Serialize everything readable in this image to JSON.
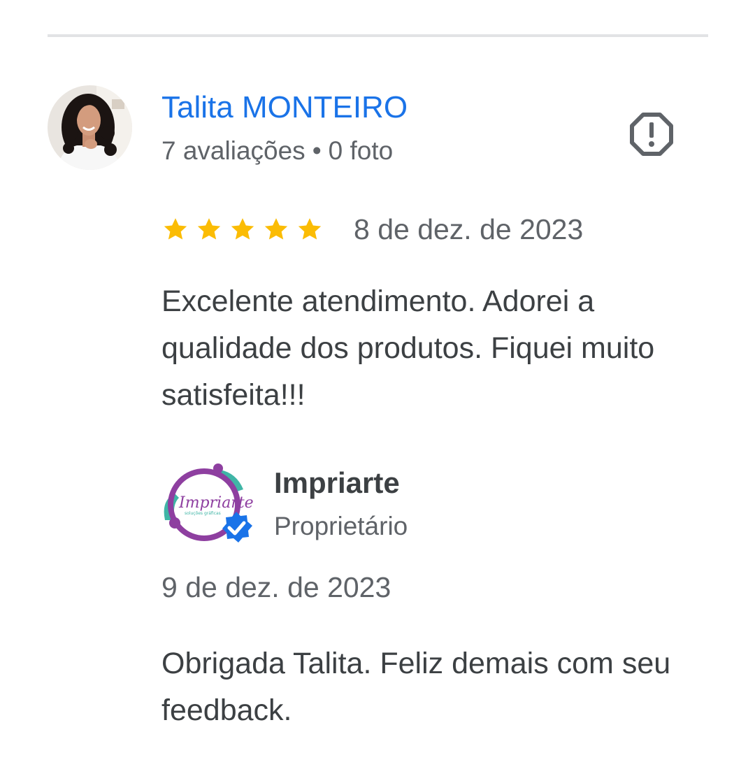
{
  "review": {
    "reviewer_name": "Talita MONTEIRO",
    "reviewer_reviews": "7 avaliações",
    "meta_separator": "•",
    "reviewer_photos": "0 foto",
    "rating": 5,
    "rating_max": 5,
    "date": "8 de dez. de 2023",
    "text": "Excelente atendimento. Adorei a qualidade dos produtos. Fiquei muito satisfeita!!!",
    "icons": {
      "report": "report-flag-icon",
      "star": "star-icon"
    }
  },
  "owner_reply": {
    "name": "Impriarte",
    "role": "Proprietário",
    "logo_text": "Impriarte",
    "logo_subtext": "soluções gráficas",
    "date": "9 de dez. de 2023",
    "text": "Obrigada Talita. Feliz demais com seu feedback.",
    "icons": {
      "verified": "verified-badge-icon"
    }
  },
  "colors": {
    "link_blue": "#1a73e8",
    "star_gold": "#fbbc04",
    "text_primary": "#3c4043",
    "text_secondary": "#5f6368",
    "divider": "#e2e3e5",
    "logo_purple": "#8e3fa0",
    "logo_teal": "#3fb5a6"
  }
}
